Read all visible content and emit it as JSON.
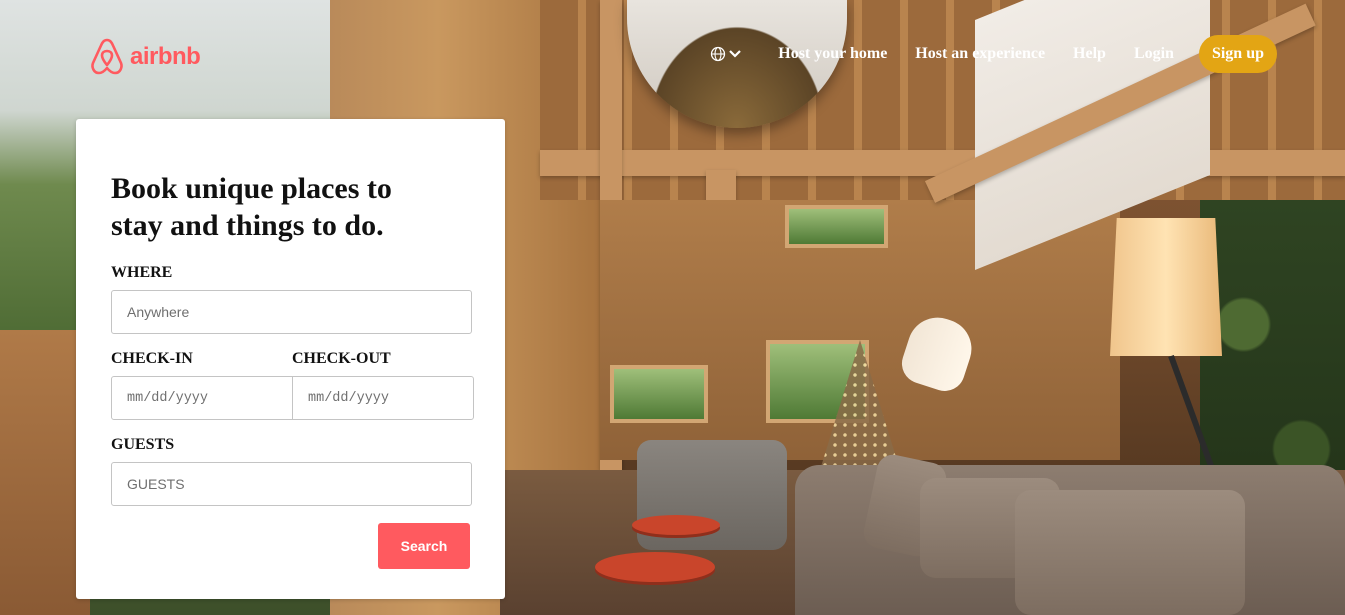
{
  "brand": {
    "name": "airbnb",
    "color": "#ff5a5f"
  },
  "header": {
    "language_icon": "globe-icon",
    "nav": {
      "host_home": "Host your home",
      "host_experience": "Host an experience",
      "help": "Help",
      "login": "Login",
      "signup": "Sign up"
    },
    "signup_color": "#e3a514"
  },
  "booking": {
    "title": "Book unique places to stay and things to do.",
    "where": {
      "label": "WHERE",
      "placeholder": "Anywhere"
    },
    "checkin": {
      "label": "CHECK-IN",
      "placeholder": "mm/dd/yyyy"
    },
    "checkout": {
      "label": "CHECK-OUT",
      "placeholder": "mm/dd/yyyy"
    },
    "guests": {
      "label": "GUESTS",
      "placeholder": "GUESTS"
    },
    "search_label": "Search"
  }
}
